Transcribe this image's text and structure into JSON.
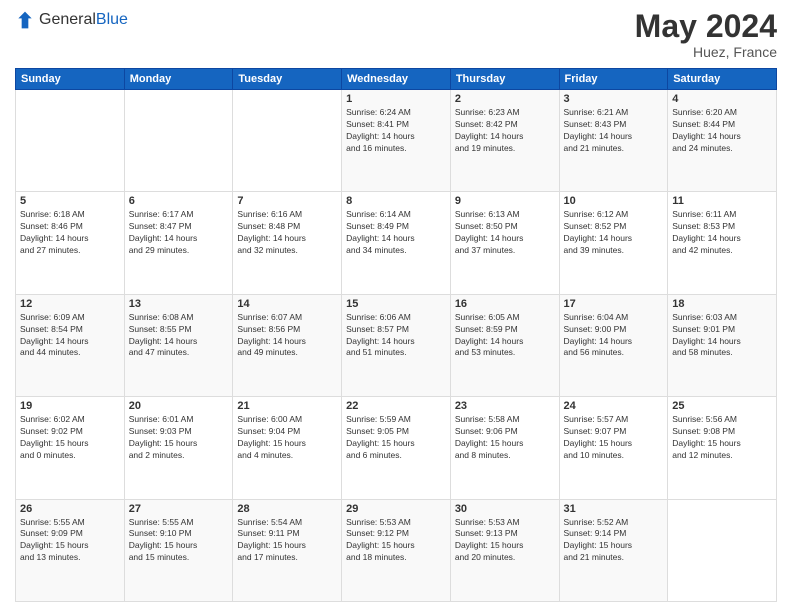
{
  "header": {
    "logo_general": "General",
    "logo_blue": "Blue",
    "month_year": "May 2024",
    "location": "Huez, France"
  },
  "days_of_week": [
    "Sunday",
    "Monday",
    "Tuesday",
    "Wednesday",
    "Thursday",
    "Friday",
    "Saturday"
  ],
  "weeks": [
    [
      {
        "day": "",
        "detail": ""
      },
      {
        "day": "",
        "detail": ""
      },
      {
        "day": "",
        "detail": ""
      },
      {
        "day": "1",
        "detail": "Sunrise: 6:24 AM\nSunset: 8:41 PM\nDaylight: 14 hours\nand 16 minutes."
      },
      {
        "day": "2",
        "detail": "Sunrise: 6:23 AM\nSunset: 8:42 PM\nDaylight: 14 hours\nand 19 minutes."
      },
      {
        "day": "3",
        "detail": "Sunrise: 6:21 AM\nSunset: 8:43 PM\nDaylight: 14 hours\nand 21 minutes."
      },
      {
        "day": "4",
        "detail": "Sunrise: 6:20 AM\nSunset: 8:44 PM\nDaylight: 14 hours\nand 24 minutes."
      }
    ],
    [
      {
        "day": "5",
        "detail": "Sunrise: 6:18 AM\nSunset: 8:46 PM\nDaylight: 14 hours\nand 27 minutes."
      },
      {
        "day": "6",
        "detail": "Sunrise: 6:17 AM\nSunset: 8:47 PM\nDaylight: 14 hours\nand 29 minutes."
      },
      {
        "day": "7",
        "detail": "Sunrise: 6:16 AM\nSunset: 8:48 PM\nDaylight: 14 hours\nand 32 minutes."
      },
      {
        "day": "8",
        "detail": "Sunrise: 6:14 AM\nSunset: 8:49 PM\nDaylight: 14 hours\nand 34 minutes."
      },
      {
        "day": "9",
        "detail": "Sunrise: 6:13 AM\nSunset: 8:50 PM\nDaylight: 14 hours\nand 37 minutes."
      },
      {
        "day": "10",
        "detail": "Sunrise: 6:12 AM\nSunset: 8:52 PM\nDaylight: 14 hours\nand 39 minutes."
      },
      {
        "day": "11",
        "detail": "Sunrise: 6:11 AM\nSunset: 8:53 PM\nDaylight: 14 hours\nand 42 minutes."
      }
    ],
    [
      {
        "day": "12",
        "detail": "Sunrise: 6:09 AM\nSunset: 8:54 PM\nDaylight: 14 hours\nand 44 minutes."
      },
      {
        "day": "13",
        "detail": "Sunrise: 6:08 AM\nSunset: 8:55 PM\nDaylight: 14 hours\nand 47 minutes."
      },
      {
        "day": "14",
        "detail": "Sunrise: 6:07 AM\nSunset: 8:56 PM\nDaylight: 14 hours\nand 49 minutes."
      },
      {
        "day": "15",
        "detail": "Sunrise: 6:06 AM\nSunset: 8:57 PM\nDaylight: 14 hours\nand 51 minutes."
      },
      {
        "day": "16",
        "detail": "Sunrise: 6:05 AM\nSunset: 8:59 PM\nDaylight: 14 hours\nand 53 minutes."
      },
      {
        "day": "17",
        "detail": "Sunrise: 6:04 AM\nSunset: 9:00 PM\nDaylight: 14 hours\nand 56 minutes."
      },
      {
        "day": "18",
        "detail": "Sunrise: 6:03 AM\nSunset: 9:01 PM\nDaylight: 14 hours\nand 58 minutes."
      }
    ],
    [
      {
        "day": "19",
        "detail": "Sunrise: 6:02 AM\nSunset: 9:02 PM\nDaylight: 15 hours\nand 0 minutes."
      },
      {
        "day": "20",
        "detail": "Sunrise: 6:01 AM\nSunset: 9:03 PM\nDaylight: 15 hours\nand 2 minutes."
      },
      {
        "day": "21",
        "detail": "Sunrise: 6:00 AM\nSunset: 9:04 PM\nDaylight: 15 hours\nand 4 minutes."
      },
      {
        "day": "22",
        "detail": "Sunrise: 5:59 AM\nSunset: 9:05 PM\nDaylight: 15 hours\nand 6 minutes."
      },
      {
        "day": "23",
        "detail": "Sunrise: 5:58 AM\nSunset: 9:06 PM\nDaylight: 15 hours\nand 8 minutes."
      },
      {
        "day": "24",
        "detail": "Sunrise: 5:57 AM\nSunset: 9:07 PM\nDaylight: 15 hours\nand 10 minutes."
      },
      {
        "day": "25",
        "detail": "Sunrise: 5:56 AM\nSunset: 9:08 PM\nDaylight: 15 hours\nand 12 minutes."
      }
    ],
    [
      {
        "day": "26",
        "detail": "Sunrise: 5:55 AM\nSunset: 9:09 PM\nDaylight: 15 hours\nand 13 minutes."
      },
      {
        "day": "27",
        "detail": "Sunrise: 5:55 AM\nSunset: 9:10 PM\nDaylight: 15 hours\nand 15 minutes."
      },
      {
        "day": "28",
        "detail": "Sunrise: 5:54 AM\nSunset: 9:11 PM\nDaylight: 15 hours\nand 17 minutes."
      },
      {
        "day": "29",
        "detail": "Sunrise: 5:53 AM\nSunset: 9:12 PM\nDaylight: 15 hours\nand 18 minutes."
      },
      {
        "day": "30",
        "detail": "Sunrise: 5:53 AM\nSunset: 9:13 PM\nDaylight: 15 hours\nand 20 minutes."
      },
      {
        "day": "31",
        "detail": "Sunrise: 5:52 AM\nSunset: 9:14 PM\nDaylight: 15 hours\nand 21 minutes."
      },
      {
        "day": "",
        "detail": ""
      }
    ]
  ]
}
